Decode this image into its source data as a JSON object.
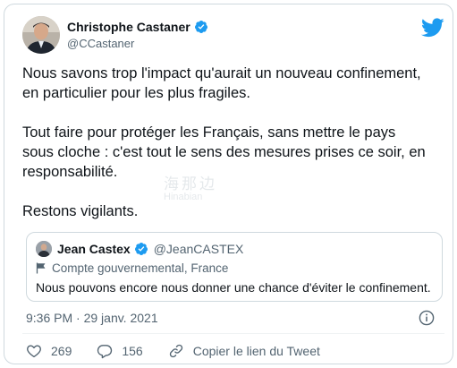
{
  "author": {
    "display_name": "Christophe Castaner",
    "handle": "@CCastaner"
  },
  "tweet": {
    "text": "Nous savons trop l'impact qu'aurait un nouveau confinement,\nen particulier pour les plus fragiles.\n\nTout faire pour protéger les Français, sans mettre le pays\nsous cloche : c'est tout le sens des mesures prises ce soir, en\nresponsabilité.\n\nRestons vigilants."
  },
  "watermark": {
    "cn": "海那边",
    "en": "Hinabian"
  },
  "quoted_tweet": {
    "display_name": "Jean Castex",
    "handle": "@JeanCASTEX",
    "label": "Compte gouvernemental, France",
    "text": "Nous pouvons encore nous donner une chance d'éviter le confinement."
  },
  "meta": {
    "timestamp": "9:36 PM · 29 janv. 2021"
  },
  "actions": {
    "likes": "269",
    "replies": "156",
    "copy_link": "Copier le lien du Tweet"
  },
  "colors": {
    "brand": "#1d9bf0",
    "text": "#0f1419",
    "secondary": "#536471",
    "border": "#cfd9de"
  },
  "icons": [
    "verified-badge-icon",
    "twitter-bird-icon",
    "flag-icon",
    "info-icon",
    "heart-icon",
    "reply-icon",
    "link-icon"
  ]
}
